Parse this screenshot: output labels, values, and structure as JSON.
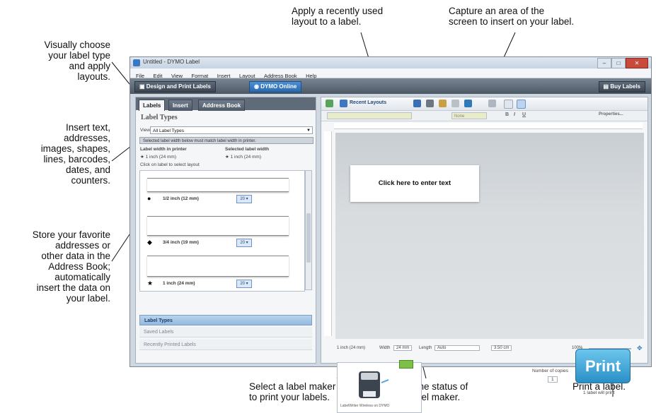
{
  "annotations": {
    "choose_layout": "Visually choose\nyour label type\nand apply\nlayouts.",
    "insert": "Insert text,\naddresses,\nimages, shapes,\nlines, barcodes,\ndates, and\ncounters.",
    "address_book": "Store your favorite\naddresses or\nother data in the\nAddress Book;\nautomatically\ninsert the data on\nyour label.",
    "recent_layout": "Apply a recently used\nlayout to a label.",
    "capture": "Capture an area of the\nscreen to insert on your label.",
    "select_maker": "Select a label maker\nto print your labels.",
    "status": "View the status of\nthe label maker.",
    "print": "Print a label."
  },
  "window": {
    "title": "Untitled - DYMO Label",
    "menu": [
      "File",
      "Edit",
      "View",
      "Format",
      "Insert",
      "Layout",
      "Address Book",
      "Help"
    ],
    "ribbon": {
      "design_tab": "Design and Print Labels",
      "online_tab": "DYMO Online",
      "buy_tab": "Buy Labels"
    }
  },
  "left_panel": {
    "tabs": [
      "Labels",
      "Insert",
      "Address Book"
    ],
    "heading": "Label Types",
    "view_label": "View:",
    "view_value": "All Label Types",
    "info_bar": "Selected label width below must match label width in printer.",
    "width_printer_label": "Label width in printer",
    "width_printer_value": "1 inch (24 mm)",
    "selected_width_label": "Selected label width",
    "selected_width_value": "1 inch (24 mm)",
    "click_hint": "Click on label to select layout",
    "labels": [
      {
        "bullet": "●",
        "size": "1/2 inch (12 mm)",
        "count": "20 ▾"
      },
      {
        "bullet": "◆",
        "size": "3/4 inch (19 mm)",
        "count": "20 ▾"
      },
      {
        "bullet": "★",
        "size": "1 inch (24 mm)",
        "count": "20 ▾"
      }
    ],
    "accordion": {
      "header": "Label Types",
      "items": [
        "Saved Labels",
        "Recently Printed Labels"
      ]
    }
  },
  "right_panel": {
    "recent_layouts": "Recent Layouts",
    "font_placeholder": "",
    "style_box": "None",
    "properties": "Properties...",
    "canvas_text": "Click here to enter text",
    "status": {
      "size": "1 inch (24 mm)",
      "width_label": "Width",
      "width_value": "24 mm",
      "length_label": "Length",
      "length_value": "Auto",
      "length_extra": "3.50 cm",
      "zoom": "100%"
    },
    "printer_name": "LabelWriter Wireless on DYMO",
    "copies_label": "Number of copies",
    "copies_value": "1",
    "print_button": "Print",
    "will_print": "1 label will print"
  }
}
